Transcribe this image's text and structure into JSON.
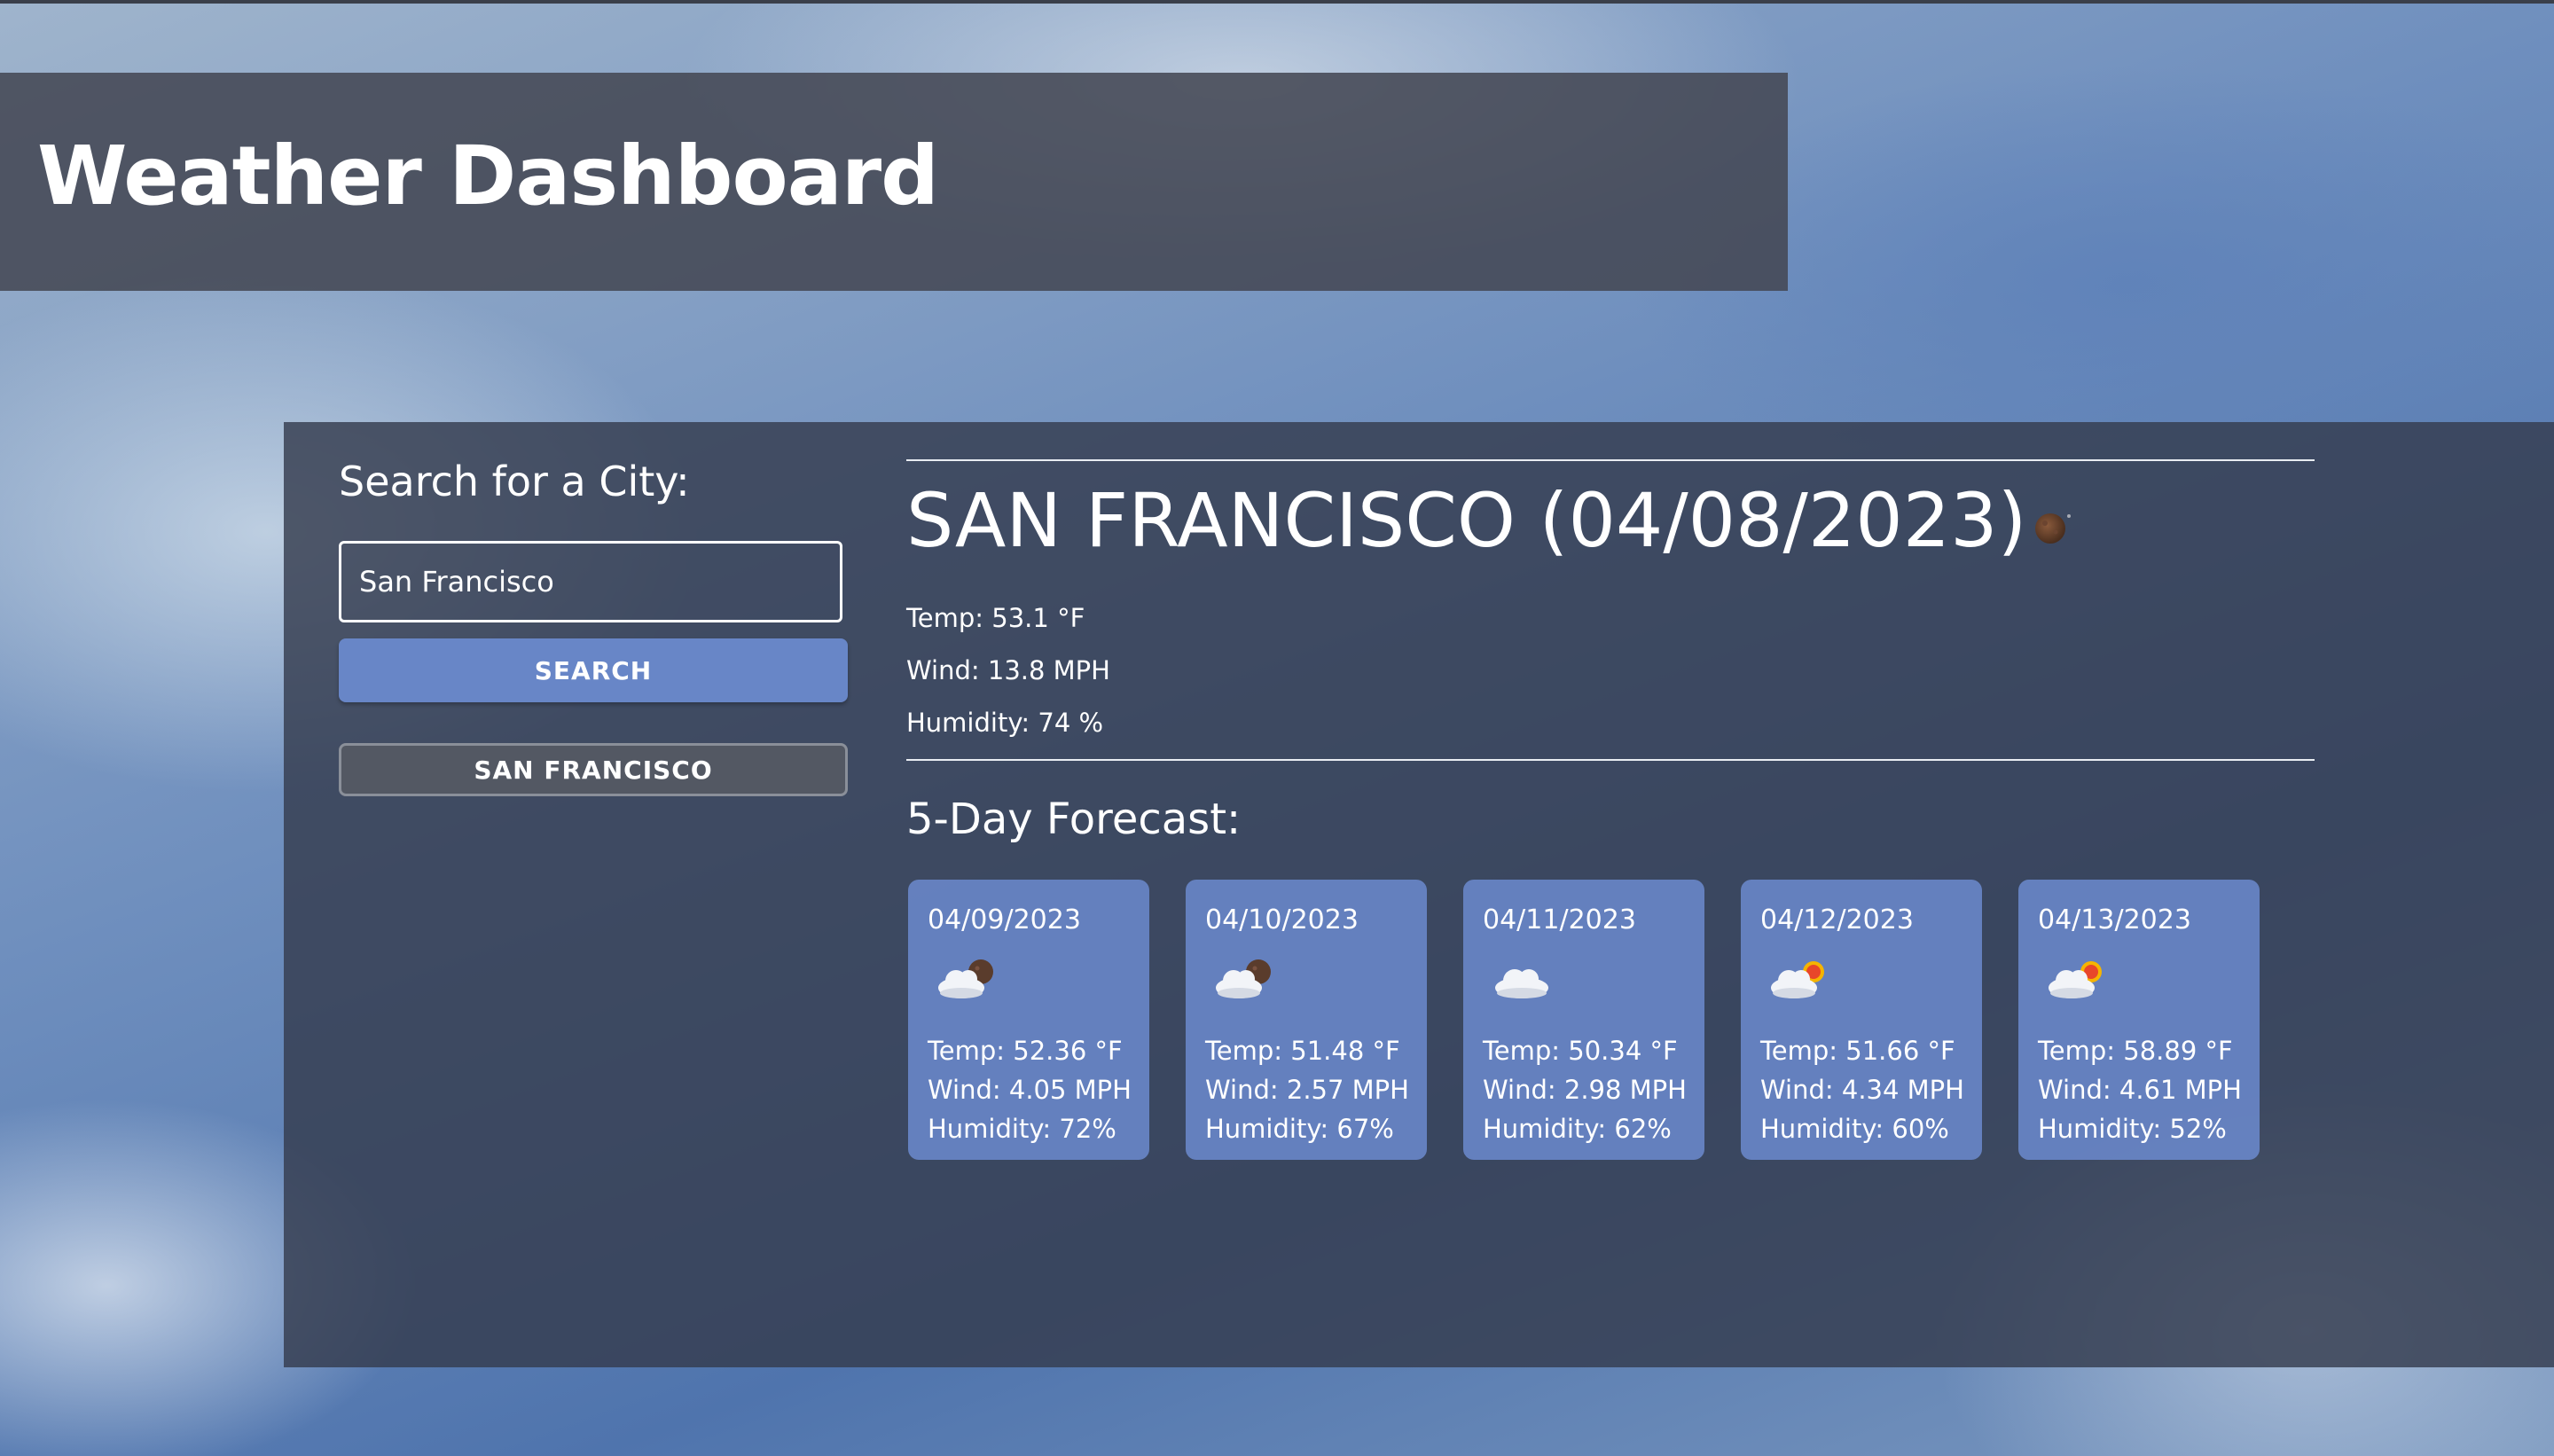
{
  "app": {
    "title": "Weather Dashboard"
  },
  "search": {
    "heading": "Search for a City:",
    "input_value": "San Francisco",
    "button_label": "SEARCH",
    "history": [
      "SAN FRANCISCO"
    ]
  },
  "current": {
    "title": "SAN FRANCISCO (04/08/2023)",
    "icon": "moon-icon",
    "temp": "Temp: 53.1 °F",
    "wind": "Wind: 13.8 MPH",
    "humidity": "Humidity: 74 %"
  },
  "forecast": {
    "heading": "5-Day Forecast:",
    "days": [
      {
        "date": "04/09/2023",
        "icon": "cloud-moon-icon",
        "temp": "Temp: 52.36 °F",
        "wind": "Wind: 4.05 MPH",
        "humidity": "Humidity: 72%"
      },
      {
        "date": "04/10/2023",
        "icon": "cloud-moon-icon",
        "temp": "Temp: 51.48 °F",
        "wind": "Wind: 2.57 MPH",
        "humidity": "Humidity: 67%"
      },
      {
        "date": "04/11/2023",
        "icon": "cloud-icon",
        "temp": "Temp: 50.34 °F",
        "wind": "Wind: 2.98 MPH",
        "humidity": "Humidity: 62%"
      },
      {
        "date": "04/12/2023",
        "icon": "cloud-sun-icon",
        "temp": "Temp: 51.66 °F",
        "wind": "Wind: 4.34 MPH",
        "humidity": "Humidity: 60%"
      },
      {
        "date": "04/13/2023",
        "icon": "cloud-sun-icon",
        "temp": "Temp: 58.89 °F",
        "wind": "Wind: 4.61 MPH",
        "humidity": "Humidity: 52%"
      }
    ]
  },
  "colors": {
    "accent": "#6886c7",
    "header_bg": "#444854",
    "panel_bg": "#343c4e",
    "history_bg": "#535863"
  }
}
